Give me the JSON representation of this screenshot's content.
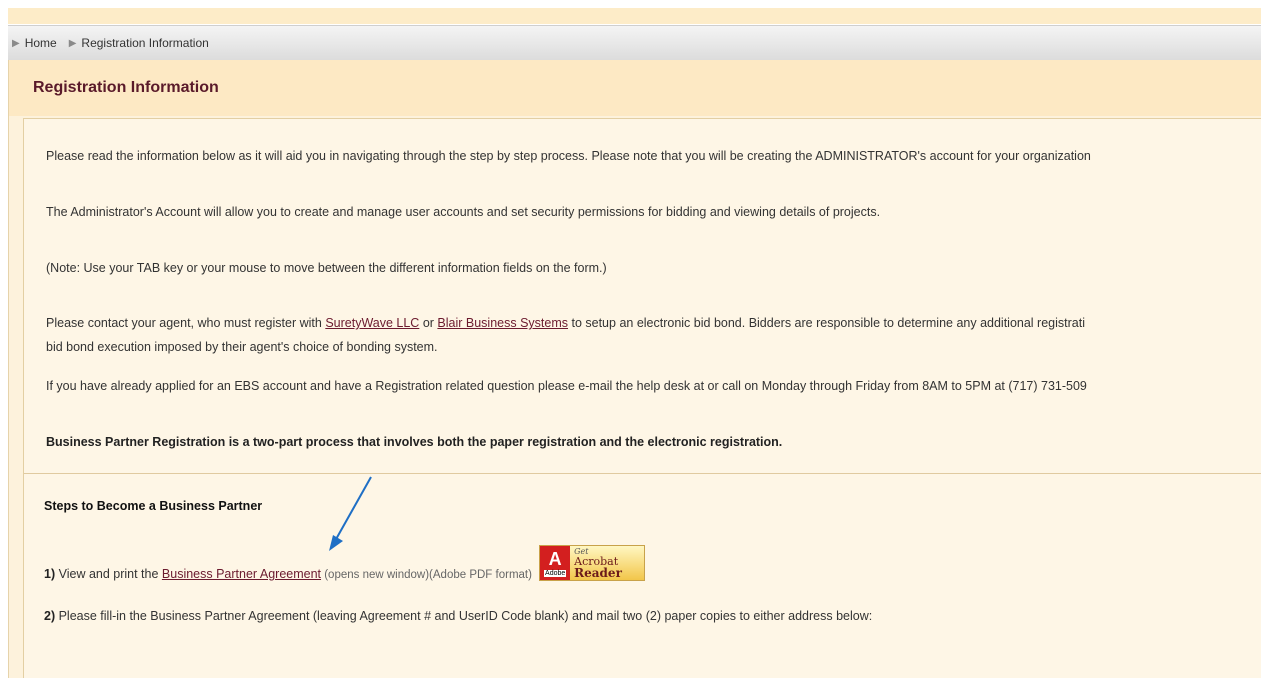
{
  "breadcrumb": {
    "items": [
      "Home",
      "Registration Information"
    ]
  },
  "header": {
    "title": "Registration Information"
  },
  "info": {
    "p1": "Please read the information below as it will aid you in navigating through the step by step process. Please note that you will be creating the ADMINISTRATOR's account for your organization",
    "p2": "The Administrator's Account will allow you to create and manage user accounts and set security permissions for bidding and viewing details of projects.",
    "p3": "(Note: Use your TAB key or your mouse to move between the different information fields on the form.)",
    "p4_pre": "Please contact your agent, who must register with ",
    "p4_link1": "SuretyWave LLC",
    "p4_mid": " or ",
    "p4_link2": "Blair Business Systems",
    "p4_post": " to setup an electronic bid bond. Bidders are responsible to determine any additional registrati",
    "p4_line2": "bid bond execution imposed by their agent's choice of bonding system.",
    "p5": "If you have already applied for an EBS account and have a Registration related question please e-mail the help desk at or call on Monday through Friday from 8AM to 5PM at (717) 731-509",
    "p6": "Business Partner Registration is a two-part process that involves both the paper registration and the electronic registration."
  },
  "steps": {
    "title": "Steps to Become a Business Partner",
    "s1_num": "1)",
    "s1_pre": " View and print the ",
    "s1_link": "Business Partner Agreement",
    "s1_note": " (opens new window)(Adobe PDF format) ",
    "s2_num": "2)",
    "s2_text": " Please fill-in the Business Partner Agreement (leaving Agreement # and UserID Code blank) and mail two (2) paper copies to either address below:",
    "adobe_badge": {
      "logo_letter": "A",
      "logo_word": "Adobe",
      "get": "Get",
      "line1": "Acrobat",
      "line2": "Reader"
    }
  },
  "colors": {
    "accent": "#5a1a2a",
    "link": "#6b1a2e",
    "background": "#fdf2dc",
    "arrow": "#1f6fc5"
  }
}
